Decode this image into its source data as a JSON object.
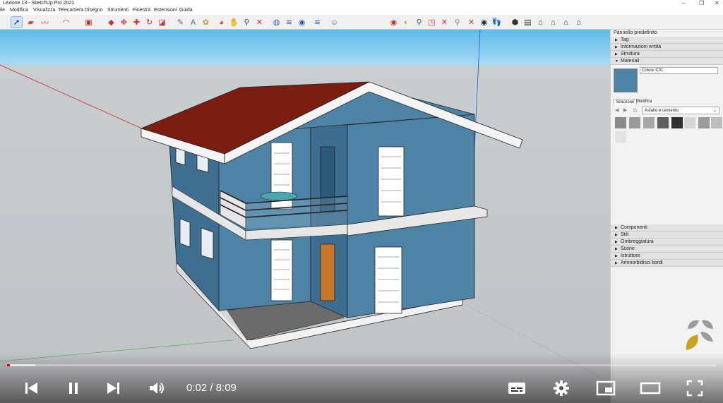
{
  "window": {
    "title": "Lezione 13 - SketchUp Pro 2021"
  },
  "menu": [
    "ile",
    "Modifica",
    "Visualizza",
    "Telecamera",
    "Disegno",
    "Strumenti",
    "Finestra",
    "Estensioni",
    "Guida"
  ],
  "toolbar_icons": [
    "select-tool",
    "eraser-tool",
    "line-tool",
    "arc-tool",
    "shape-tool",
    "pushpull-tool",
    "move-tool",
    "rotate-tool",
    "scale-tool",
    "offset-tool",
    "tape-tool",
    "text-tool",
    "paint-tool",
    "orbit-tool",
    "pan-tool",
    "zoom-tool",
    "zoom-extents-tool",
    "section-tool",
    "layers-tool",
    "components-tool",
    "styles-tool",
    "warehouse-tool"
  ],
  "panel": {
    "header": "Pannello predefinito",
    "sections_top": [
      "Tag",
      "Informazioni entità",
      "Struttura",
      "Materiali"
    ],
    "material": {
      "name": "Colore C01",
      "color": "#4d84a6"
    },
    "tabs": [
      "Selezione",
      "Modifica"
    ],
    "library": "Asfalto e cemento",
    "swatches": [
      "#8a8a8a",
      "#9a9a9a",
      "#a7a7a7",
      "#5f5f5f",
      "#303030",
      "#d6d6d6",
      "#9b9b9b",
      "#bdbdbd",
      "#e3e3e3"
    ],
    "sections_bottom": [
      "Componenti",
      "Stili",
      "Ombreggiatura",
      "Scene",
      "Istruttore",
      "Ammorbidisci bordi"
    ]
  },
  "player": {
    "time": "0:02 / 8:09",
    "played_fraction": 0.004,
    "buffered_fraction": 0.04
  }
}
